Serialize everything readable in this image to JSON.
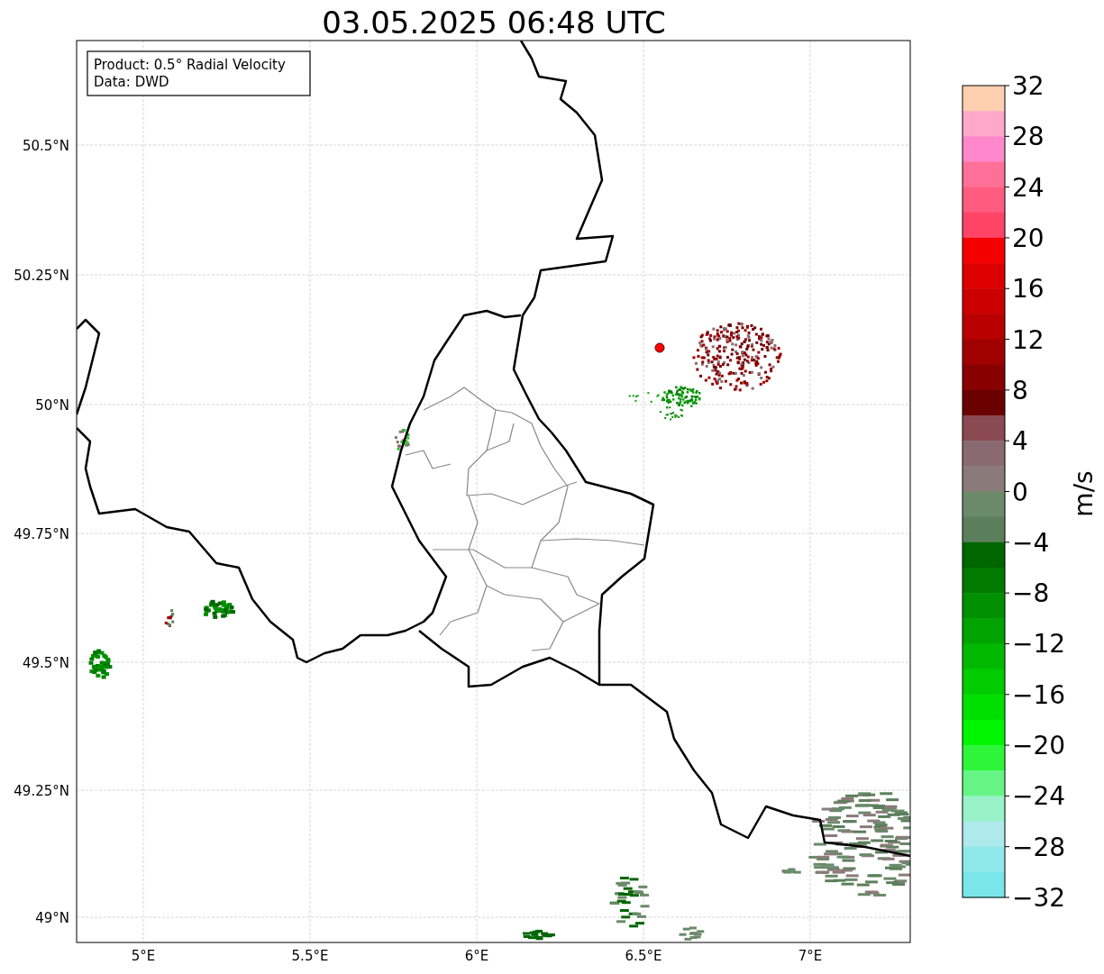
{
  "title": "03.05.2025 06:48 UTC",
  "legend": [
    "Product: 0.5° Radial Velocity",
    "Data: DWD"
  ],
  "y_ticks": [
    "50.5°N",
    "50.25°N",
    "50°N",
    "49.75°N",
    "49.5°N",
    "49.25°N",
    "49°N"
  ],
  "x_ticks": [
    "5°E",
    "5.5°E",
    "6°E",
    "6.5°E",
    "7°E"
  ],
  "colorbar": {
    "label": "m/s",
    "ticks": [
      "32",
      "28",
      "24",
      "20",
      "16",
      "12",
      "8",
      "4",
      "0",
      "−4",
      "−8",
      "−12",
      "−16",
      "−20",
      "−24",
      "−28",
      "−32"
    ],
    "bins": [
      {
        "color": "#ffd0b0"
      },
      {
        "color": "#ffa8c8"
      },
      {
        "color": "#ff88cc"
      },
      {
        "color": "#ff7098"
      },
      {
        "color": "#ff5c80"
      },
      {
        "color": "#ff4466"
      },
      {
        "color": "#f50000"
      },
      {
        "color": "#dd0000"
      },
      {
        "color": "#cc0000"
      },
      {
        "color": "#b80000"
      },
      {
        "color": "#a00000"
      },
      {
        "color": "#880000"
      },
      {
        "color": "#6b0000"
      },
      {
        "color": "#8a4a52"
      },
      {
        "color": "#8a6a72"
      },
      {
        "color": "#8b7a7a"
      },
      {
        "color": "#6a8a6a"
      },
      {
        "color": "#5b7f5b"
      },
      {
        "color": "#006600"
      },
      {
        "color": "#007a00"
      },
      {
        "color": "#008f00"
      },
      {
        "color": "#00a300"
      },
      {
        "color": "#00b800"
      },
      {
        "color": "#00cc00"
      },
      {
        "color": "#00e000"
      },
      {
        "color": "#00f500"
      },
      {
        "color": "#2ef53a"
      },
      {
        "color": "#66f584"
      },
      {
        "color": "#99f2c8"
      },
      {
        "color": "#aee9ec"
      },
      {
        "color": "#8fe8ea"
      },
      {
        "color": "#7ae6ea"
      }
    ]
  }
}
